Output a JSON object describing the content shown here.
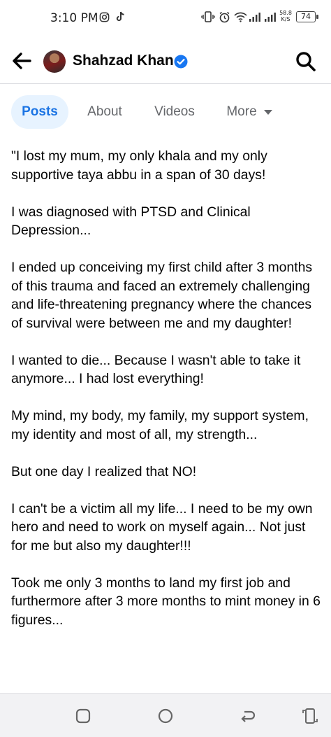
{
  "status_bar": {
    "time": "3:10 PM",
    "speed_value": "58.8",
    "speed_unit": "K/S",
    "battery": "74",
    "icons": [
      "instagram-icon",
      "tiktok-icon",
      "vibrate-icon",
      "alarm-icon",
      "wifi-icon",
      "signal-icon",
      "signal-icon-2",
      "battery-icon"
    ]
  },
  "header": {
    "name": "Shahzad Khan",
    "icons": [
      "back-arrow-icon",
      "avatar",
      "verified-badge-icon",
      "search-icon"
    ]
  },
  "tabs": [
    {
      "label": "Posts",
      "active": true
    },
    {
      "label": "About",
      "active": false
    },
    {
      "label": "Videos",
      "active": false
    },
    {
      "label": "More",
      "active": false
    }
  ],
  "post": {
    "paragraphs": [
      "\"I lost my mum, my only khala and my only supportive taya abbu in a span of 30 days!",
      "I was diagnosed with PTSD and Clinical Depression...",
      "I ended up conceiving my first child after 3 months of this trauma and faced an extremely challenging and life-threatening pregnancy where the chances of survival were between me and my daughter!",
      "I wanted to die... Because I wasn't able to take it anymore... I had lost everything!",
      "My mind, my body, my family, my support system, my identity and most of all, my strength...",
      "But one day I realized that NO!",
      "I can't be a victim all my life... I need to be my own hero and need to work on myself again... Not just for me but also my daughter!!!",
      "Took me only 3 months to land my first job and furthermore after 3 more months to mint money in 6 figures..."
    ]
  },
  "nav_bar": {
    "icons": [
      "recent-apps-icon",
      "home-icon",
      "back-icon",
      "screen-rotate-icon"
    ]
  },
  "colors": {
    "accent": "#1b74e4",
    "active_tab_bg": "#e7f3ff",
    "secondary_text": "#65676b",
    "verified": "#1877f2"
  }
}
